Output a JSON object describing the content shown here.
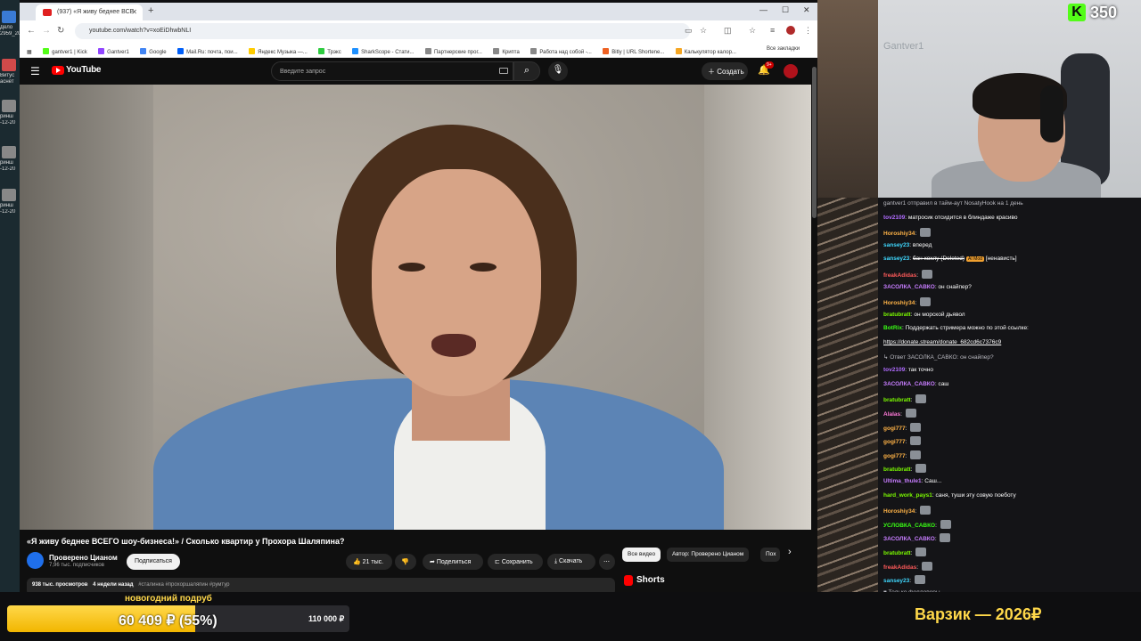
{
  "desktop": {
    "labels": [
      "Дело",
      "2959_20",
      "Витус",
      "аснет",
      "ринш",
      "-12-20",
      "ринш",
      "-12-20",
      "ринш",
      "-12-20"
    ]
  },
  "browser": {
    "tab_title": "(937) «Я живу беднее ВСЕ",
    "url": "youtube.com/watch?v=xoEiDhwbNLI",
    "bookmarks": [
      {
        "label": "gantver1 | Kick",
        "color": "#53fc18"
      },
      {
        "label": "Gantver1",
        "color": "#9146ff"
      },
      {
        "label": "Google",
        "color": "#4285f4"
      },
      {
        "label": "Mail.Ru: почта, пои...",
        "color": "#005ff9"
      },
      {
        "label": "Яндекс Музыка —...",
        "color": "#ffcc00"
      },
      {
        "label": "Трэкс",
        "color": "#2ecc40"
      },
      {
        "label": "SharkScope - Стати...",
        "color": "#1e90ff"
      },
      {
        "label": "Партнерские прог...",
        "color": "#888888"
      },
      {
        "label": "Криптa",
        "color": "#888888"
      },
      {
        "label": "Работа над собой -...",
        "color": "#888888"
      },
      {
        "label": "Bitly | URL Shortene...",
        "color": "#ee6123"
      },
      {
        "label": "Калькулятор калор...",
        "color": "#f5a623"
      }
    ],
    "all_bookmarks": "Все закладки"
  },
  "youtube": {
    "logo": "YouTube",
    "search_placeholder": "Введите запрос",
    "create_label": "Создать",
    "notif_badge": "9+",
    "video_title": "«Я живу беднее ВСЕГО шоу-бизнеса!» / Сколько квартир у Прохора Шаляпина?",
    "channel_name": "Проверено Цианом",
    "subscribers": "7,96 тыс. подписчиков",
    "subscribe_label": "Подписаться",
    "likes": "21 тыс.",
    "share_label": "Поделиться",
    "save_label": "Сохранить",
    "download_label": "Скачать",
    "views": "938 тыс. просмотров",
    "date": "4 недели назад",
    "tags": "#сталинка #прохоршаляпин #румтур",
    "chips": [
      "Все видео",
      "Автор: Проверено Цианом",
      "Пох"
    ],
    "shorts_label": "Shorts"
  },
  "stream": {
    "viewer_count": "350",
    "webcam_wall_text": "Gantver1",
    "chat": [
      {
        "type": "sys",
        "text": "gantver1 отправил в тайм-аут NosatyHook на 1 день"
      },
      {
        "user": "tov2109",
        "color": "#b06cff",
        "text": "матросик отсидится в блиндаже красиво"
      },
      {
        "user": "Horoshiy34",
        "color": "#ffb347",
        "text": "",
        "emote": true
      },
      {
        "user": "sansey23",
        "color": "#3fd8ff",
        "text": "вперед"
      },
      {
        "user": "sansey23",
        "color": "#3fd8ff",
        "text": "бан хохлу (Deleted)",
        "tag": "AI Mod",
        "extra": "[ненависть]"
      },
      {
        "user": "freakAdidas",
        "color": "#ff5a5a",
        "text": "",
        "emote": true
      },
      {
        "user": "ЗАСОЛКА_САВКО",
        "color": "#c77dff",
        "text": "он снайпер?"
      },
      {
        "user": "Horoshiy34",
        "color": "#ffb347",
        "text": "",
        "emote": true
      },
      {
        "user": "bratubratt",
        "color": "#7cfc00",
        "text": "он морской дьявол"
      },
      {
        "user": "BotRix",
        "color": "#39ff14",
        "text": "Поддержать стримера можно по этой ссылке:"
      },
      {
        "type": "link",
        "text": "https://donate.stream/donate_682cd6c7376c9"
      },
      {
        "type": "sys",
        "text": "↳ Ответ ЗАСОЛКА_САВКО: он снайпер?"
      },
      {
        "user": "tov2109",
        "color": "#b06cff",
        "text": "так точно"
      },
      {
        "user": "ЗАСОЛКА_САВКО",
        "color": "#c77dff",
        "text": "саш"
      },
      {
        "user": "bratubratt",
        "color": "#7cfc00",
        "text": "",
        "emote": true
      },
      {
        "user": "Alalas",
        "color": "#ff7ad9",
        "text": "",
        "emote": true
      },
      {
        "user": "gogi777",
        "color": "#ffb347",
        "text": "",
        "emote": true
      },
      {
        "user": "gogi777",
        "color": "#ffb347",
        "text": "",
        "emote": true
      },
      {
        "user": "gogi777",
        "color": "#ffb347",
        "text": "",
        "emote": true
      },
      {
        "user": "bratubratt",
        "color": "#7cfc00",
        "text": "",
        "emote": true
      },
      {
        "user": "Ultima_thule1",
        "color": "#c77dff",
        "text": "Саш..."
      },
      {
        "user": "hard_work_pays1",
        "color": "#7cfc00",
        "text": "саня, туши эту совую поеботу"
      },
      {
        "user": "Horoshiy34",
        "color": "#ffb347",
        "text": "",
        "emote": true
      },
      {
        "user": "УСЛОВКА_САВКО",
        "color": "#39ff14",
        "text": "",
        "emote": true
      },
      {
        "user": "ЗАСОЛКА_САВКО",
        "color": "#c77dff",
        "text": "",
        "emote": true
      },
      {
        "user": "bratubratt",
        "color": "#7cfc00",
        "text": "",
        "emote": true
      },
      {
        "user": "freakAdidas",
        "color": "#ff5a5a",
        "text": "",
        "emote": true
      },
      {
        "user": "sansey23",
        "color": "#3fd8ff",
        "text": "",
        "emote": true
      },
      {
        "type": "sys",
        "text": "♥ Только фолловеры"
      }
    ],
    "goal": {
      "title": "новогодний подруб",
      "current": "60 409 ₽ (55%)",
      "target": "110 000 ₽",
      "percent": 55
    },
    "bottom_right": "Варзик — 2026₽"
  }
}
